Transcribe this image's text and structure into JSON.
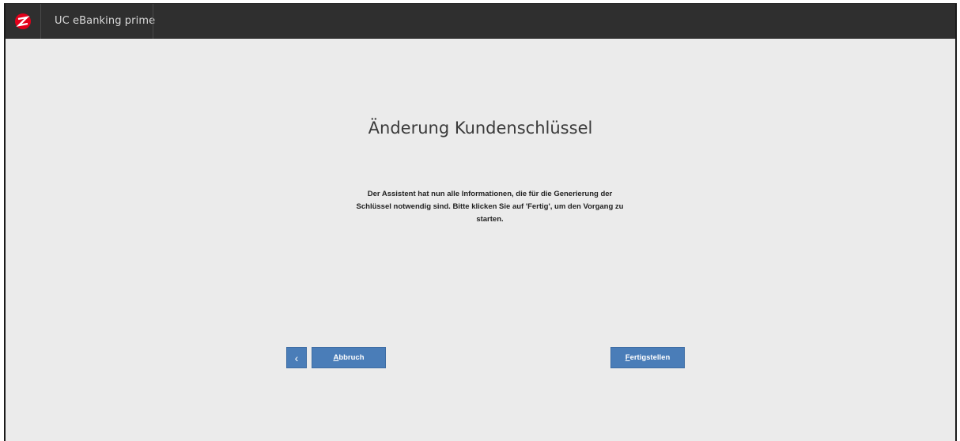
{
  "app": {
    "title": "UC eBanking prime",
    "brand_color": "#e2001a"
  },
  "wizard": {
    "heading": "Änderung Kundenschlüssel",
    "message": "Der Assistent hat nun alle Informationen, die für die Generierung der Schlüssel notwendig sind. Bitte klicken Sie auf 'Fertig', um den Vorgang zu starten."
  },
  "buttons": {
    "back_icon": "chevron-left-icon",
    "back_glyph": "‹",
    "abort_mnemonic": "A",
    "abort_rest": "bbruch",
    "finish_mnemonic": "F",
    "finish_rest": "ertigstellen",
    "color": "#4a7db8"
  }
}
